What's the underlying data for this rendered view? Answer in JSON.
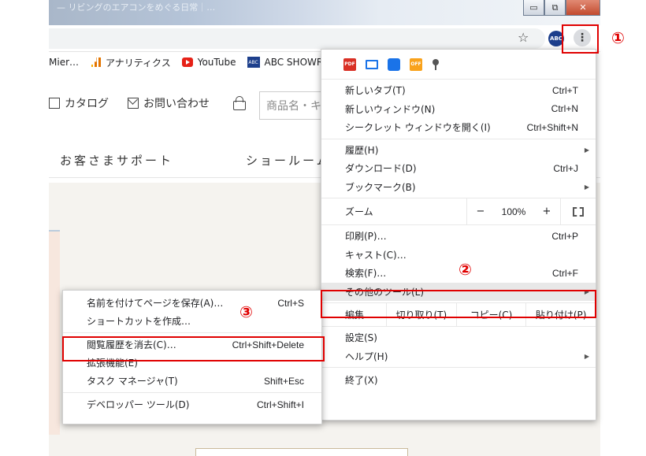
{
  "window": {
    "tab_ghost_text": "— リビングのエアコンをめぐる日常｜…",
    "minimize": "▭",
    "maximize": "⧉",
    "close": "✕"
  },
  "toolbar": {
    "star": "☆",
    "avatar": "ABC",
    "menu": "⋮"
  },
  "bookmarks": [
    {
      "label": "Mier…",
      "icon": "none"
    },
    {
      "label": "アナリティクス",
      "icon": "analytics-icon"
    },
    {
      "label": "YouTube",
      "icon": "youtube-icon"
    },
    {
      "label": "ABC SHOWRO",
      "icon": "abc-icon"
    }
  ],
  "site": {
    "nav_catalog": "カタログ",
    "nav_contact": "お問い合わせ",
    "search_placeholder": "商品名・キ",
    "subnav_support": "お客さまサポート",
    "subnav_showroom": "ショールーム"
  },
  "menu": {
    "group1": [
      {
        "label": "新しいタブ(T)",
        "shortcut": "Ctrl+T"
      },
      {
        "label": "新しいウィンドウ(N)",
        "shortcut": "Ctrl+N"
      },
      {
        "label": "シークレット ウィンドウを開く(I)",
        "shortcut": "Ctrl+Shift+N"
      }
    ],
    "group2": [
      {
        "label": "履歴(H)",
        "shortcut": "",
        "arrow": "▶"
      },
      {
        "label": "ダウンロード(D)",
        "shortcut": "Ctrl+J"
      },
      {
        "label": "ブックマーク(B)",
        "shortcut": "",
        "arrow": "▶"
      }
    ],
    "zoom": {
      "label": "ズーム",
      "minus": "−",
      "value": "100%",
      "plus": "+"
    },
    "group3": [
      {
        "label": "印刷(P)…",
        "shortcut": "Ctrl+P"
      },
      {
        "label": "キャスト(C)…",
        "shortcut": ""
      },
      {
        "label": "検索(F)…",
        "shortcut": "Ctrl+F"
      },
      {
        "label": "その他のツール(L)",
        "shortcut": "",
        "arrow": "▶"
      }
    ],
    "edit": {
      "label": "編集",
      "cut": "切り取り(T)",
      "copy": "コピー(C)",
      "paste": "貼り付け(P)"
    },
    "group4": [
      {
        "label": "設定(S)",
        "shortcut": ""
      },
      {
        "label": "ヘルプ(H)",
        "shortcut": "",
        "arrow": "▶"
      }
    ],
    "exit": {
      "label": "終了(X)"
    }
  },
  "submenu": {
    "items": [
      {
        "label": "名前を付けてページを保存(A)…",
        "shortcut": "Ctrl+S"
      },
      {
        "label": "ショートカットを作成…",
        "shortcut": ""
      },
      {
        "label": "閲覧履歴を消去(C)…",
        "shortcut": "Ctrl+Shift+Delete"
      },
      {
        "label": "拡張機能(E)",
        "shortcut": ""
      },
      {
        "label": "タスク マネージャ(T)",
        "shortcut": "Shift+Esc"
      },
      {
        "label": "デベロッパー ツール(D)",
        "shortcut": "Ctrl+Shift+I"
      }
    ]
  },
  "callouts": {
    "step1": "①",
    "step2": "②",
    "step3": "③",
    "color": "#e00000"
  }
}
